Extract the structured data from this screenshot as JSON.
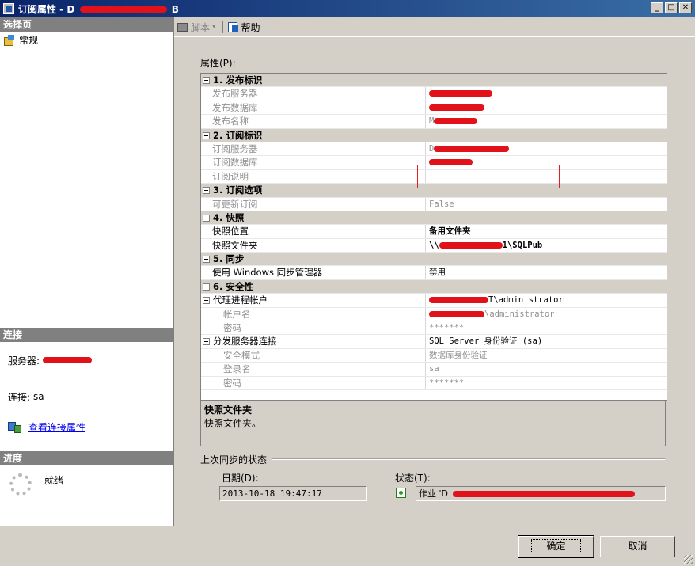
{
  "window": {
    "title_prefix": "订阅属性 - D",
    "title_suffix": "B"
  },
  "left": {
    "select_page_header": "选择页",
    "pages": [
      {
        "label": "常规"
      }
    ],
    "connection_header": "连接",
    "server_label": "服务器:",
    "connection_label": "连接:",
    "connection_value": "sa",
    "view_connection_link": "查看连接属性",
    "progress_header": "进度",
    "progress_status": "就绪"
  },
  "toolbar": {
    "script_label": "脚本",
    "help_label": "帮助"
  },
  "properties": {
    "label": "属性(P):",
    "rows": [
      {
        "type": "cat",
        "k": "1. 发布标识"
      },
      {
        "type": "ro",
        "k": "发布服务器",
        "v": "",
        "redact": 80
      },
      {
        "type": "ro",
        "k": "发布数据库",
        "v": "",
        "redact": 70
      },
      {
        "type": "ro",
        "k": "发布名称",
        "v": "M",
        "redact": 55
      },
      {
        "type": "cat",
        "k": "2. 订阅标识"
      },
      {
        "type": "ro",
        "k": "订阅服务器",
        "v": "D",
        "redact": 95
      },
      {
        "type": "ro",
        "k": "订阅数据库",
        "v": "",
        "redact": 55
      },
      {
        "type": "ro",
        "k": "订阅说明",
        "v": ""
      },
      {
        "type": "cat",
        "k": "3. 订阅选项"
      },
      {
        "type": "ro",
        "k": "可更新订阅",
        "v": "False"
      },
      {
        "type": "cat",
        "k": "4. 快照"
      },
      {
        "type": "norm bold",
        "k": "快照位置",
        "v": "备用文件夹"
      },
      {
        "type": "norm bold",
        "k": "快照文件夹",
        "v": "\\\\",
        "redact": 80,
        "v2": "1\\SQLPub"
      },
      {
        "type": "cat",
        "k": "5. 同步"
      },
      {
        "type": "norm",
        "k": "使用 Windows 同步管理器",
        "v": "禁用"
      },
      {
        "type": "cat",
        "k": "6. 安全性"
      },
      {
        "type": "parent",
        "k": "代理进程帐户",
        "v": "",
        "redact": 75,
        "v2": "T\\administrator"
      },
      {
        "type": "ro sub",
        "k": "帐户名",
        "v": "",
        "redact": 70,
        "v2": "\\administrator"
      },
      {
        "type": "ro sub",
        "k": "密码",
        "v": "*******"
      },
      {
        "type": "parent",
        "k": "分发服务器连接",
        "v": "SQL Server 身份验证 (sa)"
      },
      {
        "type": "ro sub",
        "k": "安全模式",
        "v": "数据库身份验证"
      },
      {
        "type": "ro sub",
        "k": "登录名",
        "v": "sa"
      },
      {
        "type": "ro sub",
        "k": "密码",
        "v": "*******"
      }
    ]
  },
  "description": {
    "title": "快照文件夹",
    "text": "快照文件夹。"
  },
  "sync_status": {
    "legend": "上次同步的状态",
    "date_label": "日期(D):",
    "date_value": "2013-10-18 19:47:17",
    "state_label": "状态(T):",
    "state_value_prefix": "作业 'D"
  },
  "buttons": {
    "ok": "确定",
    "cancel": "取消"
  }
}
